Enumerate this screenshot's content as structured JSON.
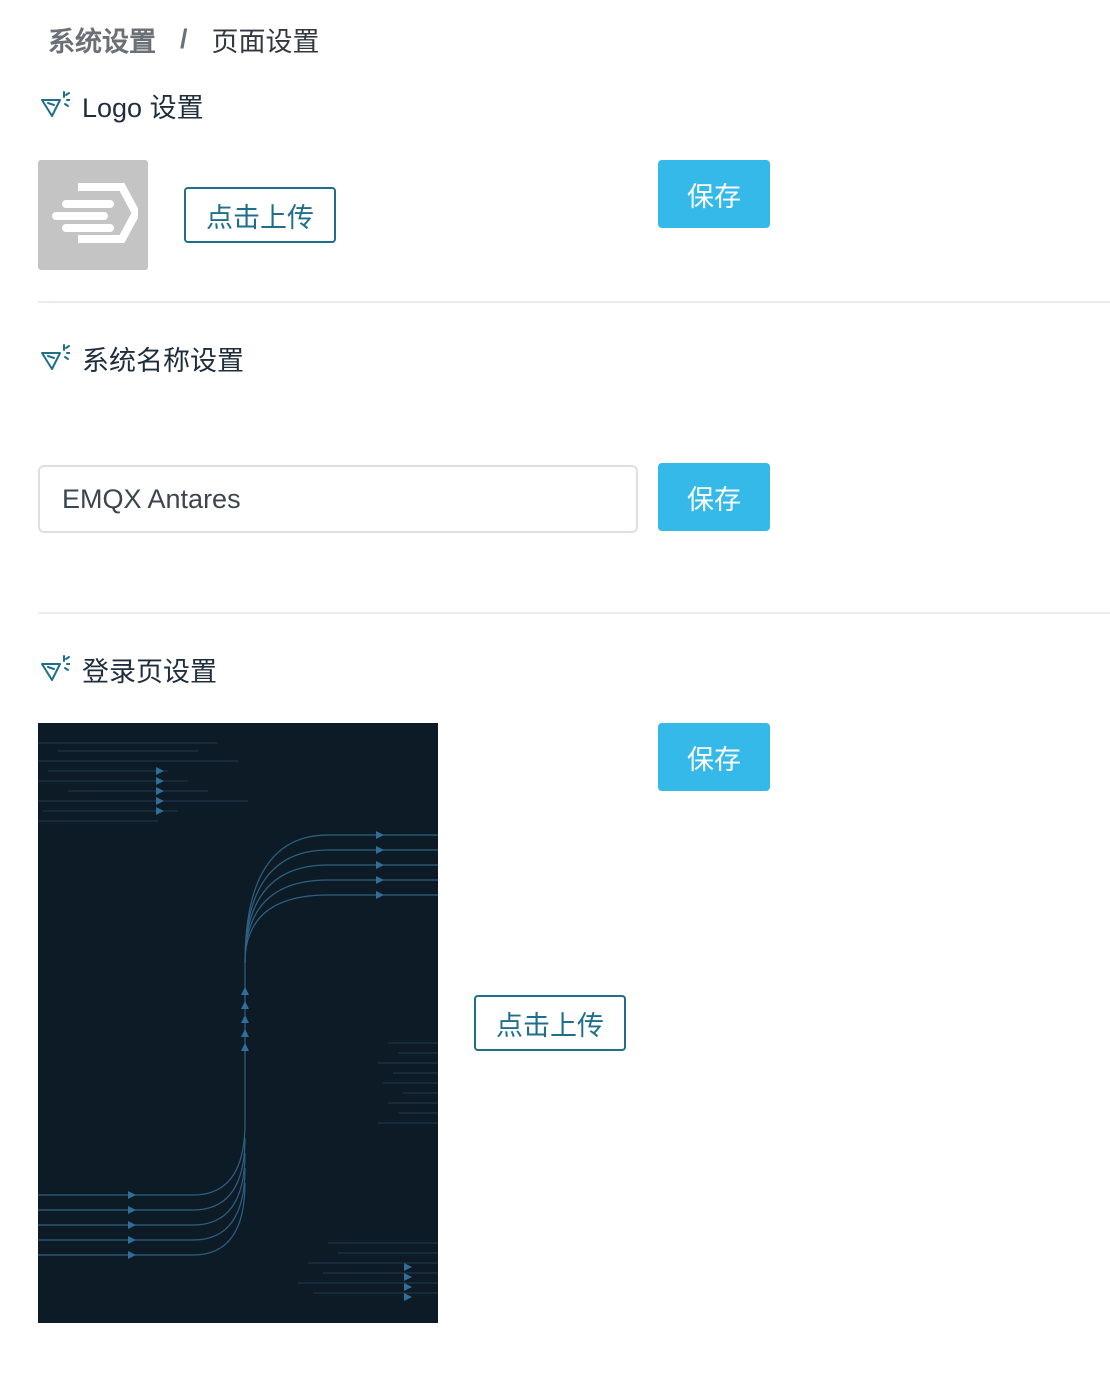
{
  "breadcrumb": {
    "parent": "系统设置",
    "separator": "/",
    "current": "页面设置"
  },
  "sections": {
    "logo": {
      "title": "Logo 设置",
      "upload_label": "点击上传",
      "save_label": "保存"
    },
    "system_name": {
      "title": "系统名称设置",
      "input_value": "EMQX Antares",
      "save_label": "保存"
    },
    "login_page": {
      "title": "登录页设置",
      "upload_label": "点击上传",
      "save_label": "保存"
    }
  },
  "icons": {
    "section_icon": "sparkle-send-icon",
    "logo": "emqx-logo-icon"
  },
  "colors": {
    "primary": "#34b9e8",
    "accent_border": "#1f6f8b",
    "preview_bg": "#0d1b26",
    "logo_bg": "#c4c4c4"
  }
}
